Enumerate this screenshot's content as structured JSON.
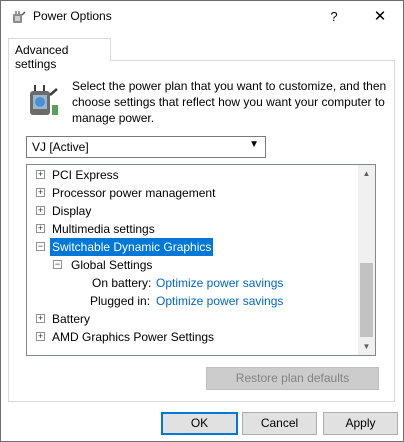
{
  "window": {
    "title": "Power Options",
    "help_label": "?",
    "close_label": "✕",
    "icon": "power-options-icon"
  },
  "tab": {
    "label": "Advanced settings"
  },
  "description": "Select the power plan that you want to customize, and then choose settings that reflect how you want your computer to manage power.",
  "plan_select": {
    "value": "VJ [Active]",
    "icon": "chevron-down-icon"
  },
  "tree": {
    "items": [
      {
        "label": "PCI Express",
        "expander": "+"
      },
      {
        "label": "Processor power management",
        "expander": "+"
      },
      {
        "label": "Display",
        "expander": "+"
      },
      {
        "label": "Multimedia settings",
        "expander": "+"
      },
      {
        "label": "Switchable Dynamic Graphics",
        "expander": "−",
        "selected": true
      },
      {
        "label": "Global Settings",
        "expander": "−"
      },
      {
        "label": "On battery:",
        "value": "Optimize power savings"
      },
      {
        "label": "Plugged in:",
        "value": "Optimize power savings"
      },
      {
        "label": "Battery",
        "expander": "+"
      },
      {
        "label": "AMD Graphics Power Settings",
        "expander": "+"
      }
    ]
  },
  "buttons": {
    "restore_defaults": "Restore plan defaults",
    "ok": "OK",
    "cancel": "Cancel",
    "apply": "Apply"
  },
  "colors": {
    "accent": "#0078d7",
    "link": "#0066cc"
  }
}
